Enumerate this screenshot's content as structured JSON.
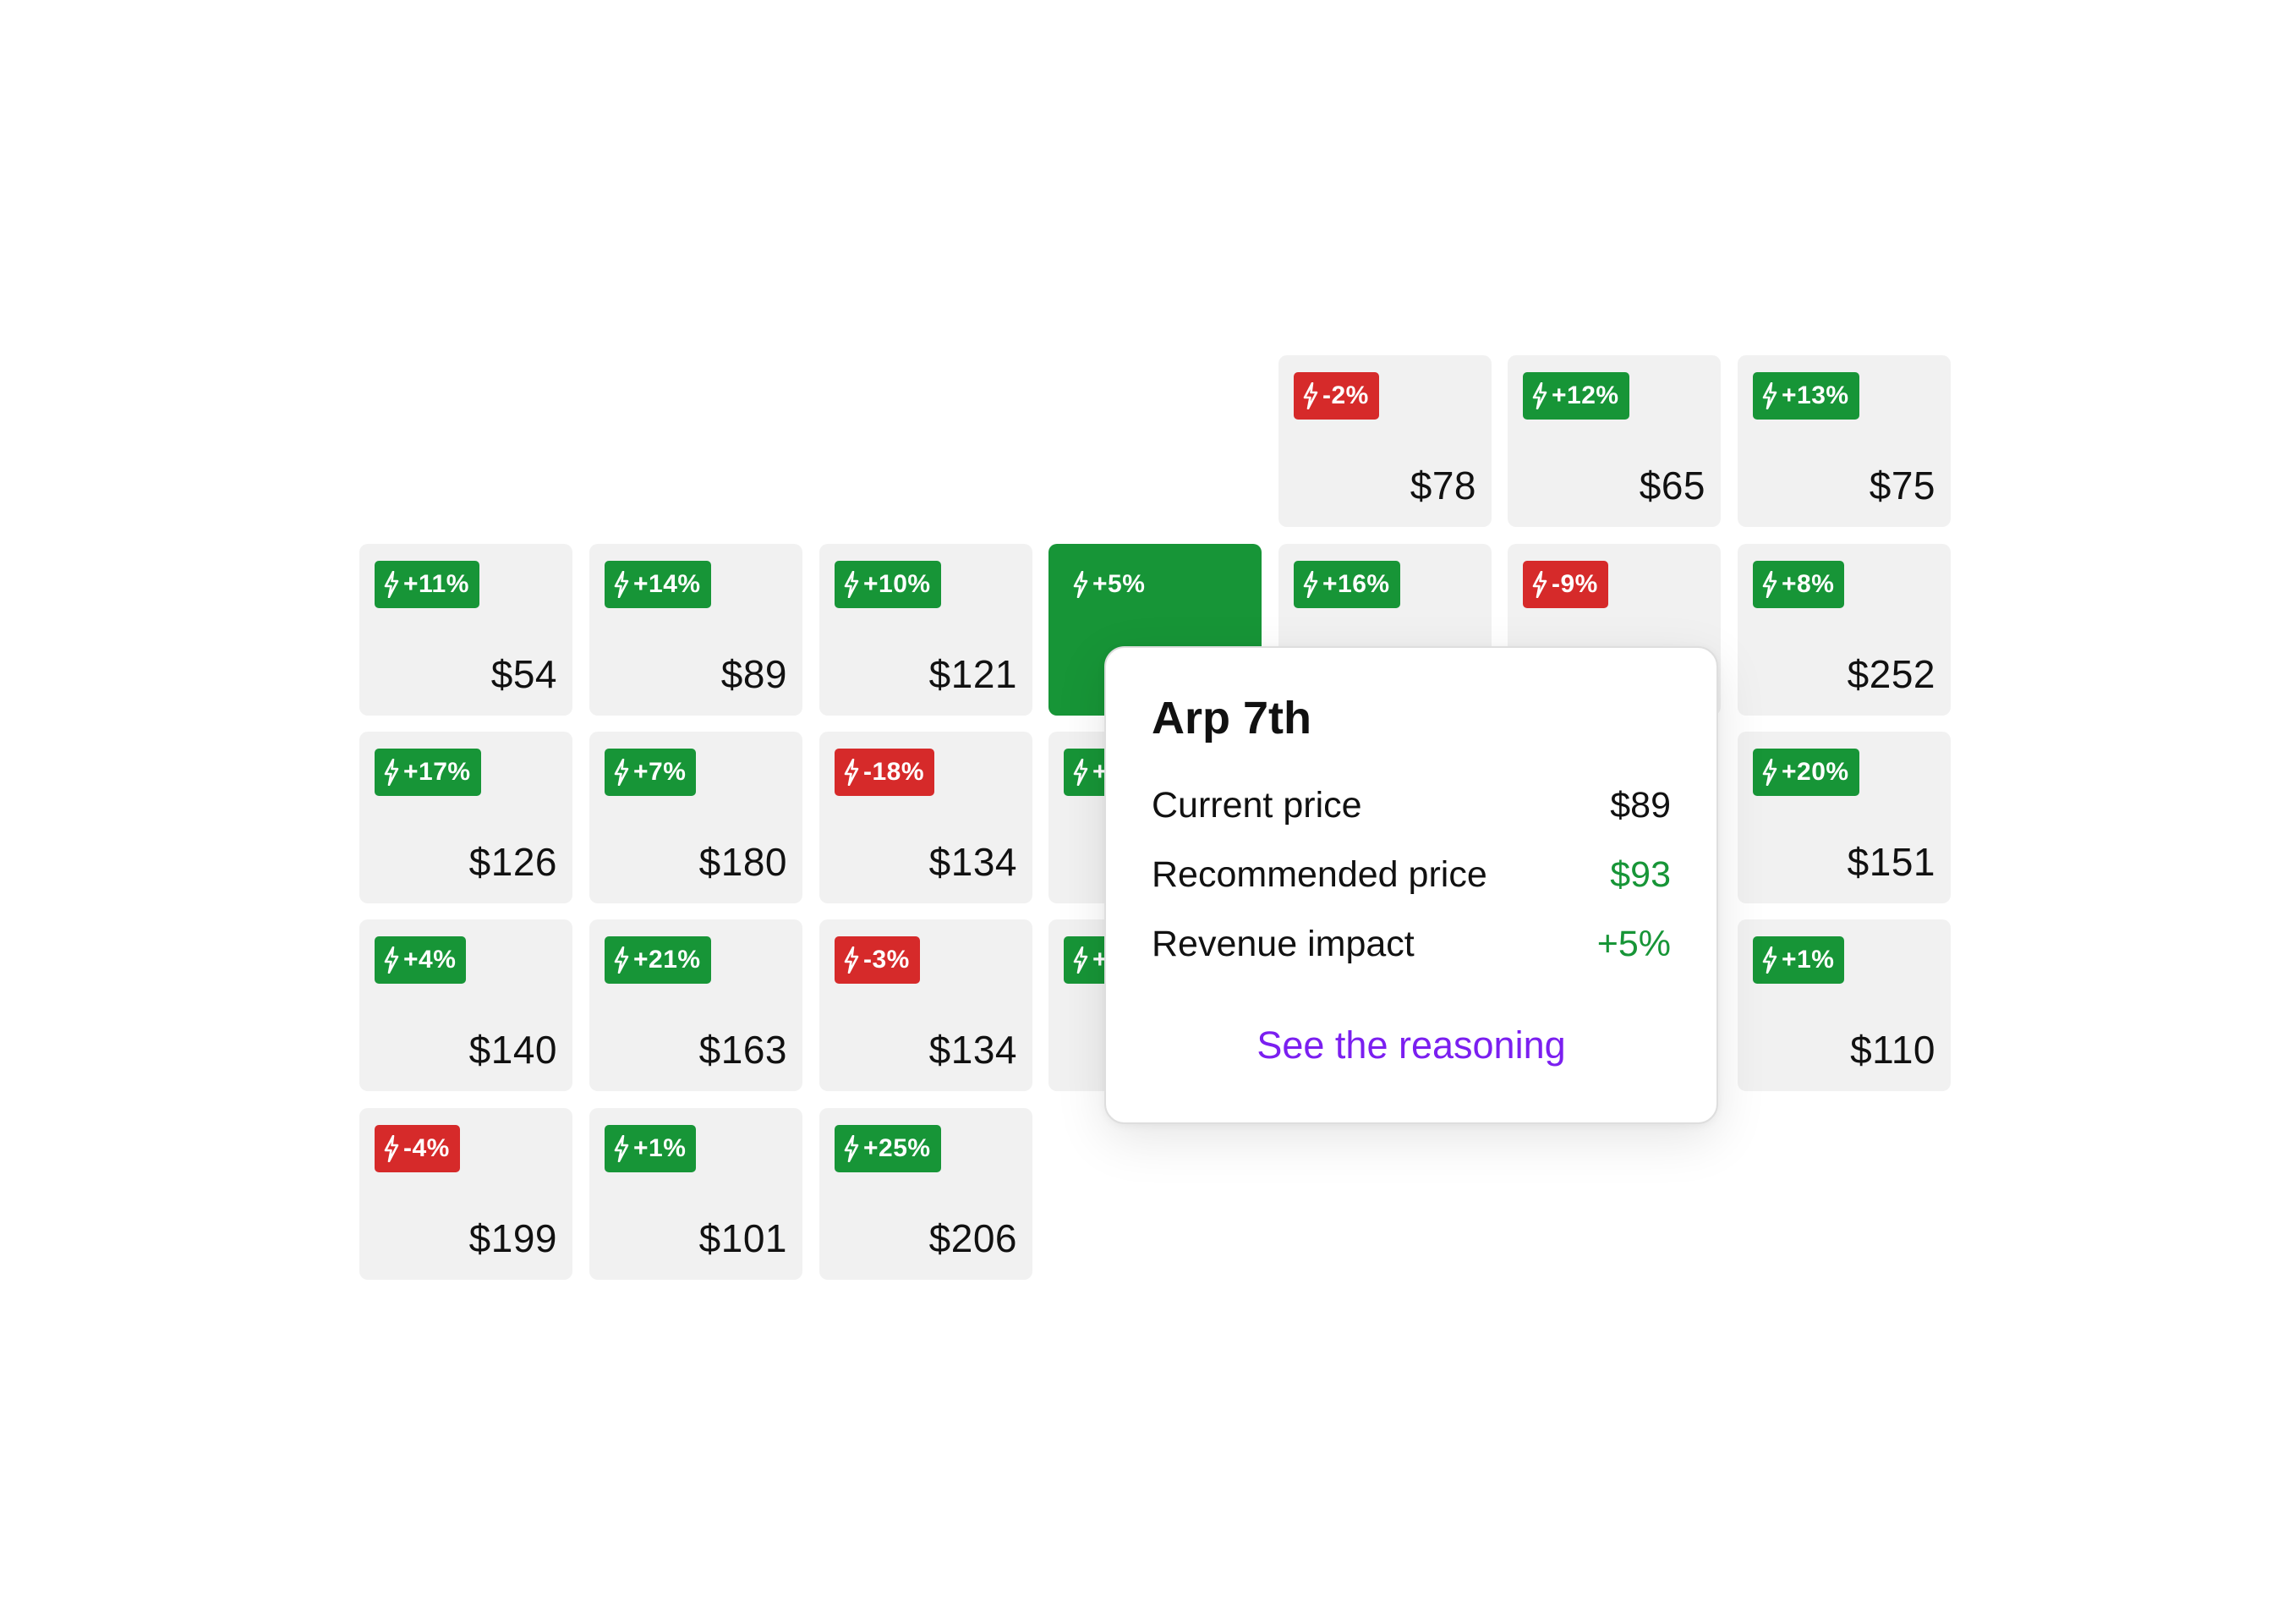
{
  "colors": {
    "positive": "#179537",
    "negative": "#d62a2a",
    "cell_background": "#f1f1f1",
    "link": "#7b1ff0"
  },
  "calendar": {
    "cells": [
      {
        "change": "-2%",
        "price": "$78",
        "trend": "down",
        "selected": false
      },
      {
        "change": "+12%",
        "price": "$65",
        "trend": "up",
        "selected": false
      },
      {
        "change": "+13%",
        "price": "$75",
        "trend": "up",
        "selected": false
      },
      {
        "change": "+11%",
        "price": "$54",
        "trend": "up",
        "selected": false
      },
      {
        "change": "+14%",
        "price": "$89",
        "trend": "up",
        "selected": false
      },
      {
        "change": "+10%",
        "price": "$121",
        "trend": "up",
        "selected": false
      },
      {
        "change": "+5%",
        "price": "",
        "trend": "up",
        "selected": true
      },
      {
        "change": "+16%",
        "price": "",
        "trend": "up",
        "selected": false
      },
      {
        "change": "-9%",
        "price": "",
        "trend": "down",
        "selected": false
      },
      {
        "change": "+8%",
        "price": "$252",
        "trend": "up",
        "selected": false
      },
      {
        "change": "+17%",
        "price": "$126",
        "trend": "up",
        "selected": false
      },
      {
        "change": "+7%",
        "price": "$180",
        "trend": "up",
        "selected": false
      },
      {
        "change": "-18%",
        "price": "$134",
        "trend": "down",
        "selected": false
      },
      {
        "change": "+",
        "price": "",
        "trend": "up",
        "selected": false
      },
      {
        "change": "+20%",
        "price": "$151",
        "trend": "up",
        "selected": false
      },
      {
        "change": "+4%",
        "price": "$140",
        "trend": "up",
        "selected": false
      },
      {
        "change": "+21%",
        "price": "$163",
        "trend": "up",
        "selected": false
      },
      {
        "change": "-3%",
        "price": "$134",
        "trend": "down",
        "selected": false
      },
      {
        "change": "+",
        "price": "",
        "trend": "up",
        "selected": false
      },
      {
        "change": "+1%",
        "price": "$110",
        "trend": "up",
        "selected": false
      },
      {
        "change": "-4%",
        "price": "$199",
        "trend": "down",
        "selected": false
      },
      {
        "change": "+1%",
        "price": "$101",
        "trend": "up",
        "selected": false
      },
      {
        "change": "+25%",
        "price": "$206",
        "trend": "up",
        "selected": false
      }
    ]
  },
  "popover": {
    "title": "Arp 7th",
    "rows": [
      {
        "label": "Current price",
        "value": "$89"
      },
      {
        "label": "Recommended price",
        "value": "$93"
      },
      {
        "label": "Revenue impact",
        "value": "+5%"
      }
    ],
    "link": "See the reasoning"
  }
}
